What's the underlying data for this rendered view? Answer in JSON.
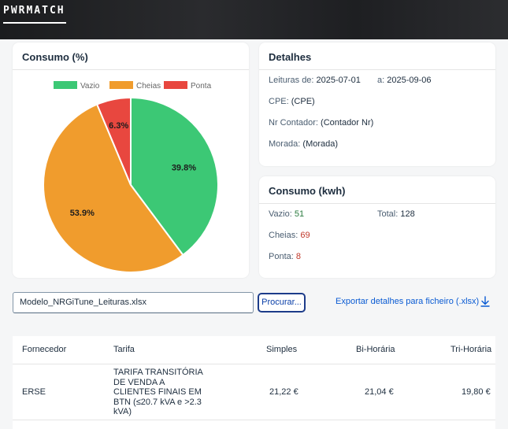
{
  "app": {
    "brand": "PWRMATCH"
  },
  "consumo_pct_card": {
    "title": "Consumo (%)"
  },
  "chart_data": {
    "type": "pie",
    "categories": [
      "Vazio",
      "Cheias",
      "Ponta"
    ],
    "values": [
      39.8,
      53.9,
      6.3
    ],
    "labels": [
      "39.8%",
      "53.9%",
      "6.3%"
    ],
    "colors": [
      "#3cc875",
      "#f09c2d",
      "#e8473f"
    ],
    "legend_position": "top"
  },
  "detalhes": {
    "title": "Detalhes",
    "leituras_label": "Leituras de:",
    "leituras_from": "2025-07-01",
    "leituras_to_label": "a:",
    "leituras_to": "2025-09-06",
    "cpe_label": "CPE:",
    "cpe_value": "(CPE)",
    "contador_label": "Nr Contador:",
    "contador_value": "(Contador Nr)",
    "morada_label": "Morada:",
    "morada_value": "(Morada)"
  },
  "consumo_kwh": {
    "title": "Consumo (kwh)",
    "vazio_label": "Vazio:",
    "vazio_value": "51",
    "total_label": "Total:",
    "total_value": "128",
    "cheias_label": "Cheias:",
    "cheias_value": "69",
    "ponta_label": "Ponta:",
    "ponta_value": "8",
    "colors": {
      "vazio": "#2a7a3f",
      "cheias": "#c0392b",
      "ponta": "#c0392b"
    }
  },
  "upload": {
    "file_value": "Modelo_NRGiTune_Leituras.xlsx",
    "browse_label": "Procurar...",
    "export_label": "Exportar detalhes para ficheiro (.xlsx)",
    "export_icon": "download-icon"
  },
  "table": {
    "headers": {
      "fornecedor": "Fornecedor",
      "tarifa": "Tarifa",
      "simples": "Simples",
      "bihoraria": "Bi-Horária",
      "trihoraria": "Tri-Horária"
    },
    "rows": [
      {
        "fornecedor": "ERSE",
        "tarifa": "TARIFA TRANSITÓRIA DE VENDA A CLIENTES FINAIS EM BTN (≤20.7 kVA e >2.3 kVA)",
        "simples": "21,22 €",
        "bihoraria": "21,04 €",
        "trihoraria": "19,80 €"
      }
    ]
  }
}
